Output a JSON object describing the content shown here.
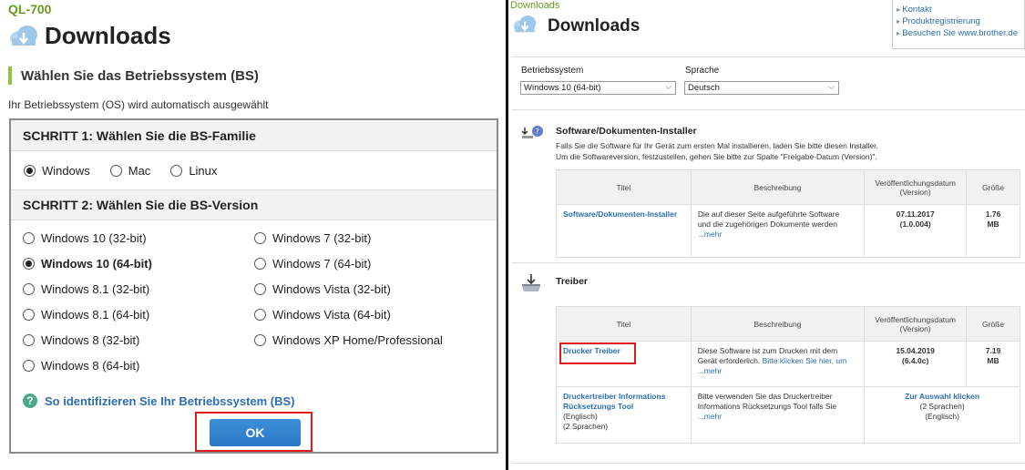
{
  "left": {
    "model": "QL-700",
    "title": "Downloads",
    "os_heading": "Wählen Sie das Betriebssystem (BS)",
    "os_sub": "Ihr Betriebssystem (OS) wird automatisch ausgewählt",
    "step1_title": "SCHRITT 1: Wählen Sie die BS-Familie",
    "families": [
      {
        "label": "Windows",
        "selected": true
      },
      {
        "label": "Mac",
        "selected": false
      },
      {
        "label": "Linux",
        "selected": false
      }
    ],
    "step2_title": "SCHRITT 2: Wählen Sie die BS-Version",
    "versions_col1": [
      {
        "label": "Windows 10 (32-bit)",
        "selected": false
      },
      {
        "label": "Windows 10 (64-bit)",
        "selected": true
      },
      {
        "label": "Windows 8.1 (32-bit)",
        "selected": false
      },
      {
        "label": "Windows 8.1 (64-bit)",
        "selected": false
      },
      {
        "label": "Windows 8 (32-bit)",
        "selected": false
      },
      {
        "label": "Windows 8 (64-bit)",
        "selected": false
      }
    ],
    "versions_col2": [
      {
        "label": "Windows 7 (32-bit)",
        "selected": false
      },
      {
        "label": "Windows 7 (64-bit)",
        "selected": false
      },
      {
        "label": "Windows Vista (32-bit)",
        "selected": false
      },
      {
        "label": "Windows Vista (64-bit)",
        "selected": false
      },
      {
        "label": "Windows XP Home/Professional",
        "selected": false
      }
    ],
    "identify_link": "So identifizieren Sie Ihr Betriebssystem (BS)",
    "ok_label": "OK"
  },
  "right": {
    "breadcrumb": "Downloads",
    "title": "Downloads",
    "top_links": [
      "Kontakt",
      "Produktregistrierung",
      "Besuchen Sie www.brother.de"
    ],
    "os_label": "Betriebssystem",
    "os_value": "Windows 10 (64-bit)",
    "lang_label": "Sprache",
    "lang_value": "Deutsch",
    "installer": {
      "title": "Software/Dokumenten-Installer",
      "desc1": "Falls Sie die Software für Ihr Gerät zum ersten Mal installieren, laden Sie bitte diesen Installer.",
      "desc2": "Um die Softwareversion, festzustellen, gehen Sie bitte zur Spalte \"Freigabe-Datum (Version)\".",
      "headers": [
        "Titel",
        "Beschreibung",
        "Veröffentlichungsdatum",
        "(Version)",
        "Größe"
      ],
      "row": {
        "name": "Software/Dokumenten-Installer",
        "desc1": "Die auf dieser Seite aufgeführte Software",
        "desc2": "und die zugehörigen Dokumente werden",
        "more": "...mehr",
        "date": "07.11.2017",
        "version": "(1.0.004)",
        "size1": "1.76",
        "size2": "MB"
      }
    },
    "driver": {
      "title": "Treiber",
      "headers": [
        "Titel",
        "Beschreibung",
        "Veröffentlichungsdatum",
        "(Version)",
        "Größe"
      ],
      "row1": {
        "name": "Drucker Treiber",
        "desc1": "Diese Software ist zum Drucken mit dem",
        "desc2a": "Gerät erforderlich. ",
        "desc2b": "Bitte klicken Sie hier, um",
        "more": "...mehr",
        "date": "15.04.2019",
        "version": "(6.4.0c)",
        "size1": "7.19",
        "size2": "MB"
      },
      "row2": {
        "name1": "Druckertreiber Informations",
        "name2": "Rücksetzungs Tool",
        "lang": "(Englisch)",
        "langs": "(2 Sprachen)",
        "desc1": "Bitte verwenden Sie das Druckertreiber",
        "desc2": "Informations Rücksetzungs Tool falls Sie",
        "more": "...mehr",
        "select": "Zur Auswahl klicken",
        "select_langs": "(2 Sprachen)",
        "select_lang": "(Englisch)"
      }
    }
  }
}
